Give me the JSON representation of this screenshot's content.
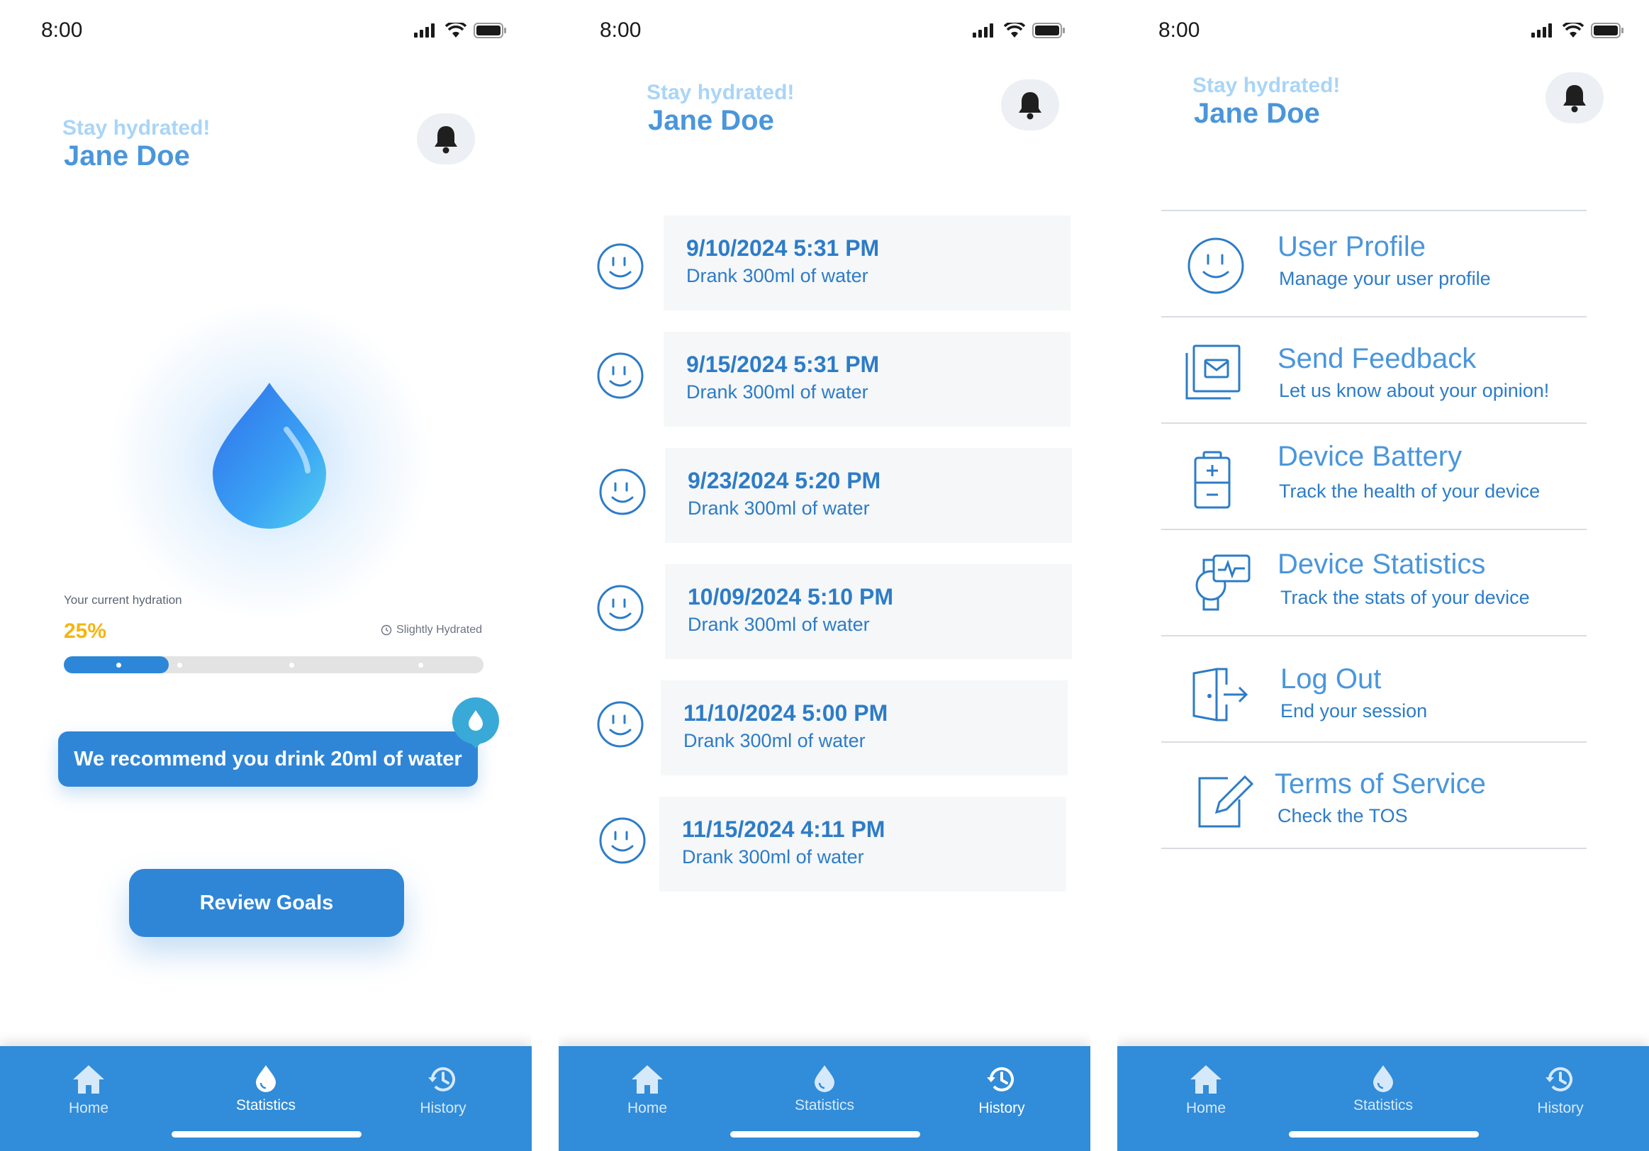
{
  "status": {
    "time": "8:00"
  },
  "header": {
    "greeting": "Stay hydrated!",
    "name": "Jane Doe"
  },
  "home": {
    "hydration_label": "Your current hydration",
    "hydration_percent": "25%",
    "hydration_fraction": 0.25,
    "hydration_status": "Slightly Hydrated",
    "recommendation": "We recommend you drink 20ml of water",
    "review_button": "Review Goals"
  },
  "history": {
    "entries": [
      {
        "date": "9/10/2024 5:31 PM",
        "text": "Drank 300ml of water"
      },
      {
        "date": "9/15/2024 5:31 PM",
        "text": "Drank 300ml of water"
      },
      {
        "date": "9/23/2024 5:20 PM",
        "text": "Drank 300ml of water"
      },
      {
        "date": "10/09/2024 5:10 PM",
        "text": "Drank 300ml of water"
      },
      {
        "date": "11/10/2024 5:00 PM",
        "text": "Drank 300ml of water"
      },
      {
        "date": "11/15/2024 4:11 PM",
        "text": "Drank 300ml of water"
      }
    ]
  },
  "settings": {
    "items": [
      {
        "title": "User Profile",
        "subtitle": "Manage your user profile",
        "icon": "smiley-icon"
      },
      {
        "title": "Send Feedback",
        "subtitle": "Let us know about your opinion!",
        "icon": "mail-icon"
      },
      {
        "title": "Device Battery",
        "subtitle": "Track the health of your device",
        "icon": "battery-icon"
      },
      {
        "title": "Device Statistics",
        "subtitle": "Track the stats of your device",
        "icon": "watch-stats-icon"
      },
      {
        "title": "Log Out",
        "subtitle": "End your session",
        "icon": "logout-icon"
      },
      {
        "title": "Terms of Service",
        "subtitle": "Check the TOS",
        "icon": "edit-icon"
      }
    ]
  },
  "nav": {
    "home": "Home",
    "statistics": "Statistics",
    "history": "History"
  },
  "colors": {
    "primary": "#318cd9",
    "accent_yellow": "#f5b50f",
    "text_blue": "#2d7cc7",
    "light_blue": "#a9d5f7"
  }
}
